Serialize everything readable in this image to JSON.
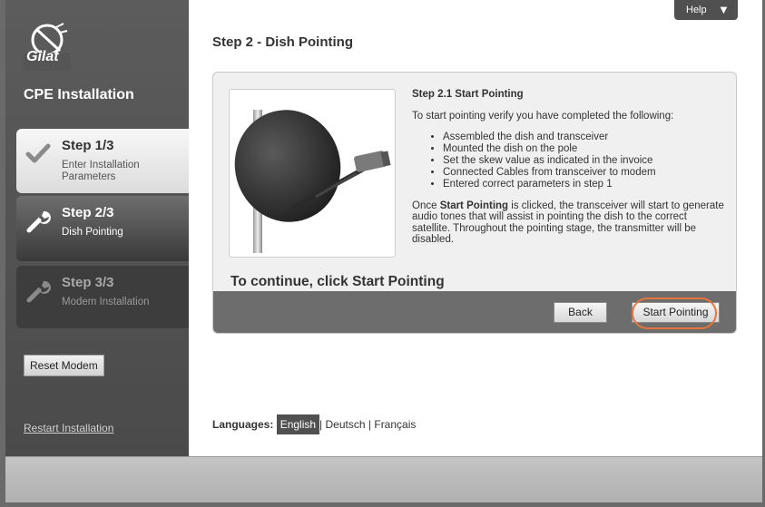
{
  "sidebar": {
    "logo_text": "Gilat",
    "title": "CPE Installation",
    "steps": [
      {
        "title": "Step 1/3",
        "subtitle": "Enter Installation Parameters",
        "status": "complete"
      },
      {
        "title": "Step 2/3",
        "subtitle": "Dish Pointing",
        "status": "active"
      },
      {
        "title": "Step 3/3",
        "subtitle": "Modem Installation",
        "status": "pending"
      }
    ],
    "reset_label": "Reset Modem",
    "restart_label": "Restart Installation"
  },
  "header": {
    "help_label": "Help",
    "help_arrow": "▼",
    "page_title": "Step 2 - Dish Pointing"
  },
  "panel": {
    "heading": "Step 2.1 Start Pointing",
    "intro": "To start pointing verify you have completed the following:",
    "checklist": [
      "Assembled the dish and transceiver",
      "Mounted the dish on the pole",
      "Set the skew value as indicated in the invoice",
      "Connected Cables from transceiver to modem",
      "Entered correct parameters in step 1"
    ],
    "para_prefix": "Once ",
    "para_bold": "Start Pointing",
    "para_rest": " is clicked, the transceiver will start to generate audio tones that will assist in pointing the dish to the correct satellite. Throughout the pointing stage, the transmitter will be disabled.",
    "continue_text": "To continue, click Start Pointing",
    "back_label": "Back",
    "start_label": "Start Pointing"
  },
  "languages": {
    "label": "Languages:",
    "options": [
      "English",
      "Deutsch",
      "Français"
    ],
    "separator": "|"
  },
  "colors": {
    "highlight": "#e8743a",
    "sidebar": "#4a4a4a"
  }
}
